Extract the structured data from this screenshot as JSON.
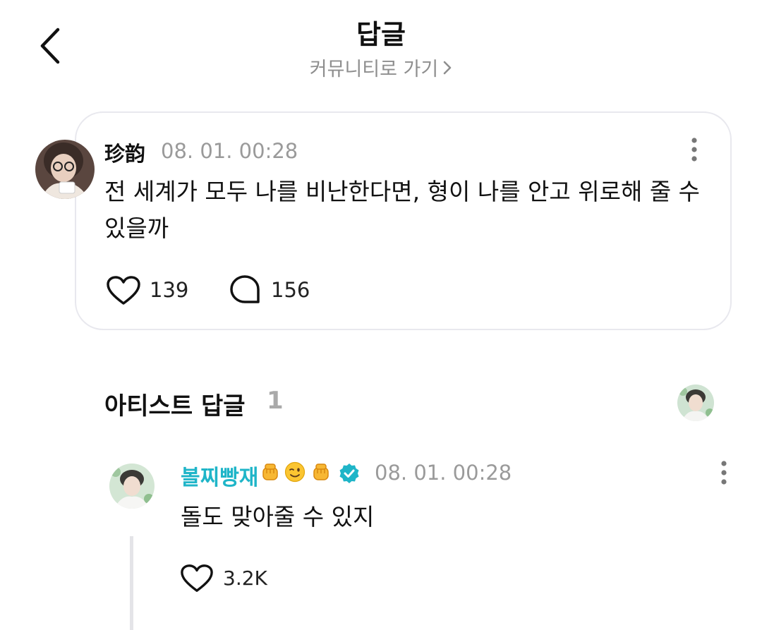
{
  "header": {
    "title": "답글",
    "community_link": "커뮤니티로 가기"
  },
  "post": {
    "author": "珍韵",
    "time": "08. 01. 00:28",
    "text": "전 세계가 모두 나를 비난한다면, 형이 나를 안고 위로해 줄 수 있을까",
    "likes": "139",
    "comments": "156"
  },
  "artist_replies": {
    "label": "아티스트 답글",
    "count": "1"
  },
  "reply": {
    "author": "볼찌빵재",
    "time": "08. 01. 00:28",
    "text": "돌도 맞아줄 수 있지",
    "likes": "3.2K",
    "author_color": "#1fb5c8",
    "emojis": [
      "raised-fist-emoji",
      "winking-face-emoji",
      "raised-fist-emoji"
    ]
  },
  "icons": [
    "back-arrow-icon",
    "chevron-right-icon",
    "more-vertical-icon",
    "heart-icon",
    "comment-bubble-icon",
    "verified-badge-icon"
  ]
}
